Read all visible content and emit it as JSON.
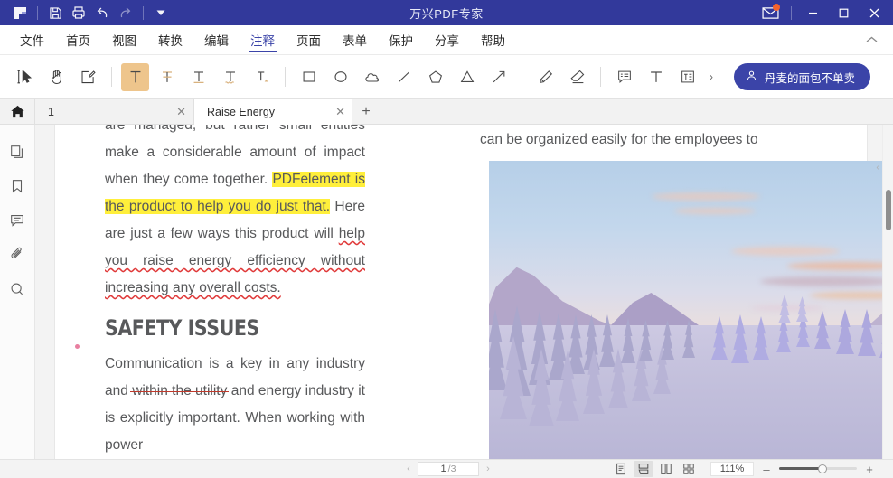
{
  "window": {
    "title": "万兴PDF专家",
    "accent": "#32399b",
    "brand_blue": "#3b44a8",
    "quick_access": [
      "logo-icon",
      "save-icon",
      "print-icon",
      "undo-icon",
      "redo-icon",
      "customize-icon"
    ],
    "mail_label": "",
    "minimize_label": "—",
    "maximize_label": "▢",
    "close_label": "✕"
  },
  "menu": {
    "items": [
      {
        "label": "文件",
        "active": false
      },
      {
        "label": "首页",
        "active": false
      },
      {
        "label": "视图",
        "active": false
      },
      {
        "label": "转换",
        "active": false
      },
      {
        "label": "编辑",
        "active": false
      },
      {
        "label": "注释",
        "active": true
      },
      {
        "label": "页面",
        "active": false
      },
      {
        "label": "表单",
        "active": false
      },
      {
        "label": "保护",
        "active": false
      },
      {
        "label": "分享",
        "active": false
      },
      {
        "label": "帮助",
        "active": false
      }
    ]
  },
  "toolbar": {
    "tools": [
      {
        "name": "select-tool",
        "active": false
      },
      {
        "name": "hand-tool",
        "active": false
      },
      {
        "name": "note-tool",
        "active": false
      },
      {
        "name": "highlight-tool",
        "active": true
      },
      {
        "name": "strikethrough-tool",
        "active": false
      },
      {
        "name": "underline-tool",
        "active": false
      },
      {
        "name": "squiggly-tool",
        "active": false
      },
      {
        "name": "text-replace-tool",
        "active": false
      },
      {
        "name": "rectangle-tool",
        "active": false
      },
      {
        "name": "ellipse-tool",
        "active": false
      },
      {
        "name": "cloud-tool",
        "active": false
      },
      {
        "name": "line-tool",
        "active": false
      },
      {
        "name": "pentagon-tool",
        "active": false
      },
      {
        "name": "triangle-tool",
        "active": false
      },
      {
        "name": "arrow-tool",
        "active": false
      },
      {
        "name": "pencil-tool",
        "active": false
      },
      {
        "name": "eraser-tool",
        "active": false
      },
      {
        "name": "comment-box-tool",
        "active": false
      },
      {
        "name": "text-tool",
        "active": false
      },
      {
        "name": "text-box-tool",
        "active": false
      }
    ],
    "more_label": "›",
    "account_label": "丹麦的面包不单卖"
  },
  "tabs": {
    "home_label": "",
    "items": [
      {
        "label": "1",
        "active": false,
        "close": "✕"
      },
      {
        "label": "Raise Energy",
        "active": true,
        "close": "✕"
      }
    ],
    "add_label": "+"
  },
  "sidebar": {
    "items": [
      {
        "name": "thumbnails-icon",
        "label": ""
      },
      {
        "name": "bookmark-icon",
        "label": ""
      },
      {
        "name": "comments-icon",
        "label": ""
      },
      {
        "name": "attachments-icon",
        "label": ""
      },
      {
        "name": "search-icon",
        "label": ""
      }
    ],
    "expand_label": "›"
  },
  "document": {
    "left_column": {
      "clipped_line": "are managed, but rather small entities that",
      "para_a": "make a considerable amount of impact when they come together. ",
      "highlighted": "PDFelement is the product to help you do just that.",
      "para_b": " Here are just a few ways this product will ",
      "squiggly": "help you raise energy efficiency without increasing any overall costs.",
      "heading": "SAFETY ISSUES",
      "para_c1": "Communication is a key in any industry and ",
      "struck": "within the utility",
      "para_c2": " and energy industry it is explicitly important. When working with power"
    },
    "right_column": {
      "line_top": "can be organized easily for the employees to",
      "image_alt": "snowy-mountain-forest-photo"
    },
    "highlight_color": "#ffef3b",
    "markup_red": "#c0392b"
  },
  "status": {
    "prev_label": "‹",
    "next_label": "›",
    "page_current": "1",
    "page_total": "/3",
    "view_modes": [
      {
        "name": "single-page-view",
        "selected": false
      },
      {
        "name": "continuous-scroll-view",
        "selected": true
      },
      {
        "name": "two-page-view",
        "selected": false
      },
      {
        "name": "thumbnail-grid-view",
        "selected": false
      }
    ],
    "zoom_value": "111%",
    "zoom_out_label": "–",
    "zoom_in_label": "+"
  }
}
